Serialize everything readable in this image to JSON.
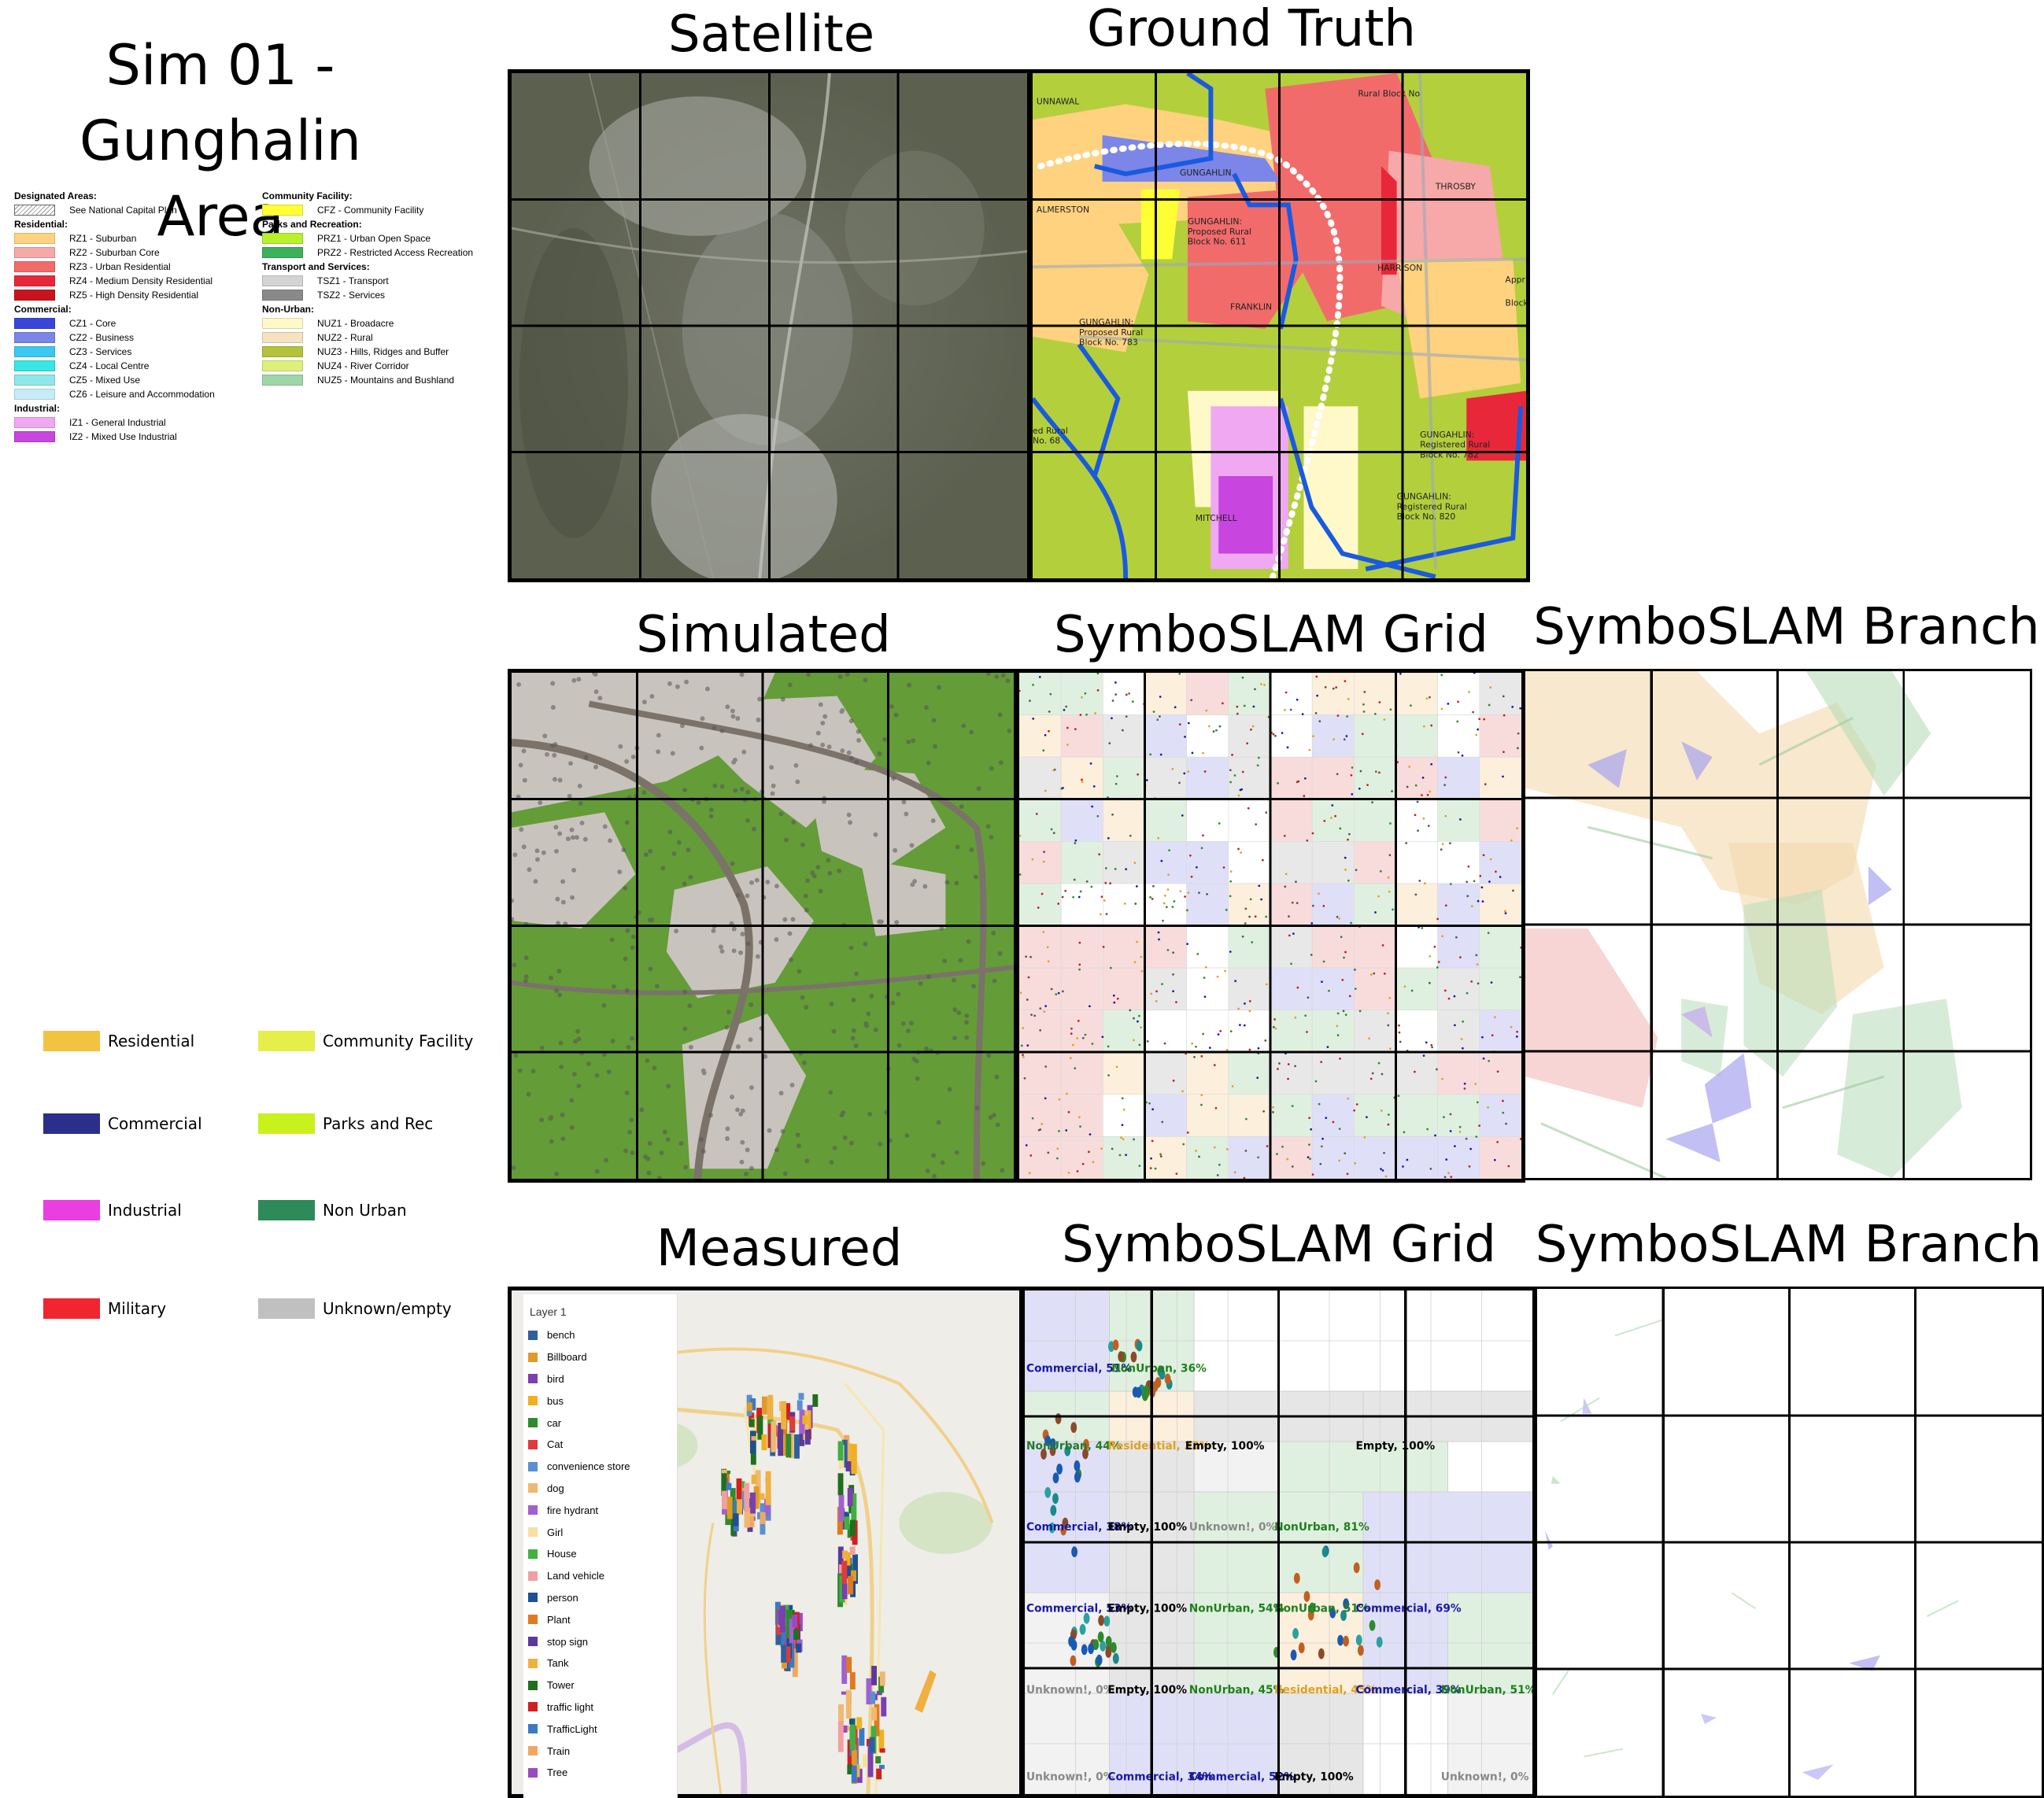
{
  "main_title": {
    "line1": "Sim 01 -",
    "line2": "Gunghalin Area"
  },
  "panel_titles": {
    "satellite": "Satellite",
    "ground_truth": "Ground Truth",
    "simulated": "Simulated",
    "grid_sim": "SymboSLAM Grid",
    "branch_sim": "SymboSLAM Branch",
    "measured": "Measured",
    "grid_meas": "SymboSLAM Grid",
    "branch_meas": "SymboSLAM Branch"
  },
  "zoning_legend": {
    "left": [
      {
        "type": "header",
        "text": "Designated Areas:"
      },
      {
        "type": "item",
        "text": "See National Capital Plan",
        "color": "hatch"
      },
      {
        "type": "header",
        "text": "Residential:"
      },
      {
        "type": "item",
        "text": "RZ1 - Suburban",
        "color": "#ffd27f"
      },
      {
        "type": "item",
        "text": "RZ2 - Suburban Core",
        "color": "#f7a8a8"
      },
      {
        "type": "item",
        "text": "RZ3 - Urban Residential",
        "color": "#f26b6b"
      },
      {
        "type": "item",
        "text": "RZ4 - Medium Density Residential",
        "color": "#e8283a"
      },
      {
        "type": "item",
        "text": "RZ5 - High Density Residential",
        "color": "#c8141e"
      },
      {
        "type": "header",
        "text": "Commercial:"
      },
      {
        "type": "item",
        "text": "CZ1 - Core",
        "color": "#3a46d8"
      },
      {
        "type": "item",
        "text": "CZ2 - Business",
        "color": "#7b86e8"
      },
      {
        "type": "item",
        "text": "CZ3 - Services",
        "color": "#3cc8f0"
      },
      {
        "type": "item",
        "text": "CZ4 - Local Centre",
        "color": "#38e6e6"
      },
      {
        "type": "item",
        "text": "CZ5 - Mixed Use",
        "color": "#8ee8ea"
      },
      {
        "type": "item",
        "text": "CZ6 - Leisure and Accommodation",
        "color": "#c7ecf8"
      },
      {
        "type": "header",
        "text": "Industrial:"
      },
      {
        "type": "item",
        "text": "IZ1 - General Industrial",
        "color": "#f0a8f2"
      },
      {
        "type": "item",
        "text": "IZ2 - Mixed Use Industrial",
        "color": "#c845e0"
      }
    ],
    "right": [
      {
        "type": "header",
        "text": "Community Facility:"
      },
      {
        "type": "item",
        "text": "CFZ - Community Facility",
        "color": "#ffff33"
      },
      {
        "type": "header",
        "text": "Parks and Recreation:"
      },
      {
        "type": "item",
        "text": "PRZ1 - Urban Open Space",
        "color": "#b8f02a"
      },
      {
        "type": "item",
        "text": "PRZ2 - Restricted Access Recreation",
        "color": "#3cb05a"
      },
      {
        "type": "header",
        "text": "Transport and Services:"
      },
      {
        "type": "item",
        "text": "TSZ1 - Transport",
        "color": "#d4d4d4"
      },
      {
        "type": "item",
        "text": "TSZ2 - Services",
        "color": "#8a8a8a"
      },
      {
        "type": "header",
        "text": "Non-Urban:"
      },
      {
        "type": "item",
        "text": "NUZ1 - Broadacre",
        "color": "#fff8c8"
      },
      {
        "type": "item",
        "text": "NUZ2 - Rural",
        "color": "#f5e2c0"
      },
      {
        "type": "item",
        "text": "NUZ3 - Hills, Ridges and Buffer",
        "color": "#b5c23a"
      },
      {
        "type": "item",
        "text": "NUZ4 - River Corridor",
        "color": "#dff07a"
      },
      {
        "type": "item",
        "text": "NUZ5 - Mountains and Bushland",
        "color": "#9ed6a8"
      }
    ]
  },
  "category_legend": [
    {
      "label": "Residential",
      "color": "#f2c241"
    },
    {
      "label": "Community Facility",
      "color": "#e4ef4a"
    },
    {
      "label": "Commercial",
      "color": "#2b2f8c"
    },
    {
      "label": "Parks and Rec",
      "color": "#c9f21c"
    },
    {
      "label": "Industrial",
      "color": "#ea3ee0"
    },
    {
      "label": "Non Urban",
      "color": "#2e8a58"
    },
    {
      "label": "Military",
      "color": "#ef2530"
    },
    {
      "label": "Unknown/empty",
      "color": "#c0c0c0"
    }
  ],
  "ground_truth_labels": [
    "UNNAWAL",
    "GUNGAHLIN",
    "THROSBY",
    "ALMERSTON",
    "GUNGAHLIN:",
    "Proposed Rural",
    "Block No. 611",
    "HARRISON",
    "FRANKLIN",
    "GUNGAHLIN:",
    "Proposed Rural",
    "Block No. 783",
    "GUNGAHLIN:",
    "Registered Rural",
    "Block No. 782",
    "MITCHELL",
    "GUNGAHLIN:",
    "Registered Rural",
    "Block No. 820",
    "Rural Block No",
    "ed Rural",
    "No. 68",
    "Appr",
    "Block"
  ],
  "measured_legend": {
    "header": "Layer 1",
    "items": [
      {
        "label": "bench",
        "color": "#2f5fa0"
      },
      {
        "label": "Billboard",
        "color": "#e09a2a"
      },
      {
        "label": "bird",
        "color": "#7b3fb0"
      },
      {
        "label": "bus",
        "color": "#f0b020"
      },
      {
        "label": "car",
        "color": "#2e8a2e"
      },
      {
        "label": "Cat",
        "color": "#e03a3a"
      },
      {
        "label": "convenience store",
        "color": "#5b8fd0"
      },
      {
        "label": "dog",
        "color": "#f0b870"
      },
      {
        "label": "fire hydrant",
        "color": "#a060d0"
      },
      {
        "label": "Girl",
        "color": "#f5e0a0"
      },
      {
        "label": "House",
        "color": "#40b040"
      },
      {
        "label": "Land vehicle",
        "color": "#f0a0a0"
      },
      {
        "label": "person",
        "color": "#1f4f8f"
      },
      {
        "label": "Plant",
        "color": "#e07a20"
      },
      {
        "label": "stop sign",
        "color": "#5a3a9a"
      },
      {
        "label": "Tank",
        "color": "#f0b040"
      },
      {
        "label": "Tower",
        "color": "#1f6f1f"
      },
      {
        "label": "traffic light",
        "color": "#d02020"
      },
      {
        "label": "TrafficLight",
        "color": "#3a7ac0"
      },
      {
        "label": "Train",
        "color": "#f0a860"
      },
      {
        "label": "Tree",
        "color": "#9a4ac0"
      }
    ]
  },
  "measured_grid_labels": [
    {
      "text": "Commercial, 51%",
      "color": "#1a1aa0"
    },
    {
      "text": "NonUrban, 36%",
      "color": "#1f7f1f"
    },
    {
      "text": "NonUrban, 44%",
      "color": "#1f7f1f"
    },
    {
      "text": "Residential, 33%",
      "color": "#e0a020"
    },
    {
      "text": "Empty, 100%",
      "color": "#000000"
    },
    {
      "text": "Empty, 100%",
      "color": "#000000"
    },
    {
      "text": "Commercial, 38%",
      "color": "#1a1aa0"
    },
    {
      "text": "Empty, 100%",
      "color": "#000000"
    },
    {
      "text": "Unknown!, 0%",
      "color": "#888888"
    },
    {
      "text": "NonUrban, 81%",
      "color": "#1f7f1f"
    },
    {
      "text": "Commercial, 53%",
      "color": "#1a1aa0"
    },
    {
      "text": "Empty, 100%",
      "color": "#000000"
    },
    {
      "text": "NonUrban, 54%",
      "color": "#1f7f1f"
    },
    {
      "text": "NonUrban, 51%",
      "color": "#1f7f1f"
    },
    {
      "text": "Commercial, 69%",
      "color": "#1a1aa0"
    },
    {
      "text": "Unknown!, 0%",
      "color": "#888888"
    },
    {
      "text": "Empty, 100%",
      "color": "#000000"
    },
    {
      "text": "NonUrban, 45%",
      "color": "#1f7f1f"
    },
    {
      "text": "Residential, 45%",
      "color": "#e0a020"
    },
    {
      "text": "Commercial, 39%",
      "color": "#1a1aa0"
    },
    {
      "text": "NonUrban, 51%",
      "color": "#1f7f1f"
    },
    {
      "text": "Unknown!, 0%",
      "color": "#888888"
    },
    {
      "text": "Commercial, 34%",
      "color": "#1a1aa0"
    },
    {
      "text": "Commercial, 52%",
      "color": "#1a1aa0"
    },
    {
      "text": "Empty, 100%",
      "color": "#000000"
    },
    {
      "text": "Unknown!, 0%",
      "color": "#888888"
    }
  ]
}
